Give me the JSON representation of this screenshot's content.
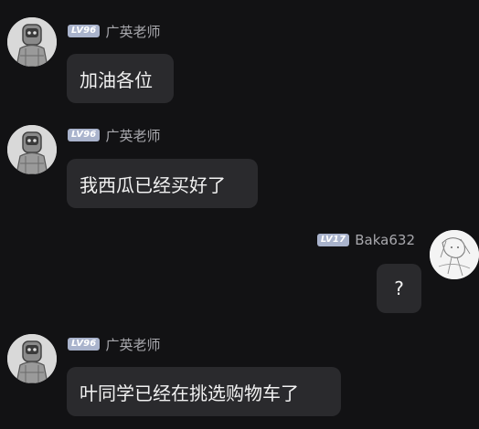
{
  "messages": [
    {
      "side": "left",
      "sender": "广英老师",
      "level": "LV96",
      "text": "加油各位",
      "avatar": "robot-astronaut-avatar"
    },
    {
      "side": "left",
      "sender": "广英老师",
      "level": "LV96",
      "text": "我西瓜已经买好了",
      "avatar": "robot-astronaut-avatar"
    },
    {
      "side": "right",
      "sender": "Baka632",
      "level": "LV17",
      "text": "?",
      "avatar": "sketch-character-avatar"
    },
    {
      "side": "left",
      "sender": "广英老师",
      "level": "LV96",
      "text": "叶同学已经在挑选购物车了",
      "avatar": "robot-astronaut-avatar"
    }
  ],
  "colors": {
    "background": "#121214",
    "bubble": "#2a2a2d",
    "level_badge": "#a9b3cc",
    "nickname": "#a8a8ad"
  }
}
